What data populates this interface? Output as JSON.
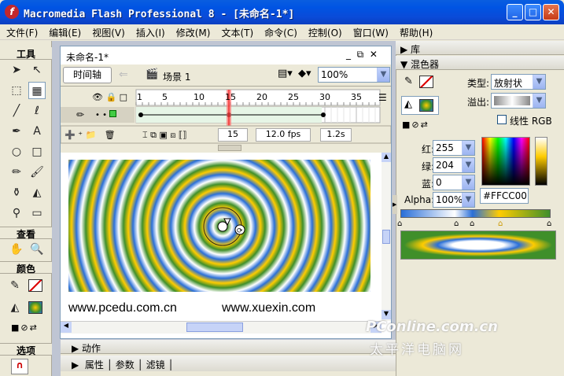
{
  "window": {
    "title": "Macromedia Flash Professional 8 - [未命名-1*]",
    "app_icon": "f"
  },
  "menu": [
    "文件(F)",
    "编辑(E)",
    "视图(V)",
    "插入(I)",
    "修改(M)",
    "文本(T)",
    "命令(C)",
    "控制(O)",
    "窗口(W)",
    "帮助(H)"
  ],
  "tools": {
    "header": "工具",
    "view_header": "查看",
    "colors_header": "颜色",
    "options_header": "选项"
  },
  "document": {
    "tab": "未命名-1*",
    "timeline_button": "时间轴",
    "scene": "场景 1",
    "zoom": "100%"
  },
  "timeline": {
    "frame_numbers": [
      "1",
      "5",
      "10",
      "15",
      "20",
      "25",
      "30",
      "35"
    ],
    "current_frame": "15",
    "fps": "12.0 fps",
    "elapsed": "1.2s"
  },
  "stage": {
    "left_text": "www.pcedu.com.cn",
    "right_text": "www.xuexin.com"
  },
  "bottom_panels": {
    "actions": "动作",
    "properties": "属性",
    "params": "参数",
    "filters": "滤镜"
  },
  "library_panel": {
    "title": "库"
  },
  "mixer_panel": {
    "title": "混色器",
    "type_label": "类型:",
    "type_value": "放射状",
    "overflow_label": "溢出:",
    "linear_rgb": "线性 RGB",
    "r_label": "红:",
    "r": "255",
    "g_label": "绿:",
    "g": "204",
    "b_label": "蓝:",
    "b": "0",
    "alpha_label": "Alpha:",
    "alpha": "100%",
    "hex": "#FFCC00"
  },
  "watermark": {
    "line1": "PConline.com.cn",
    "line2": "太平洋电脑网"
  }
}
